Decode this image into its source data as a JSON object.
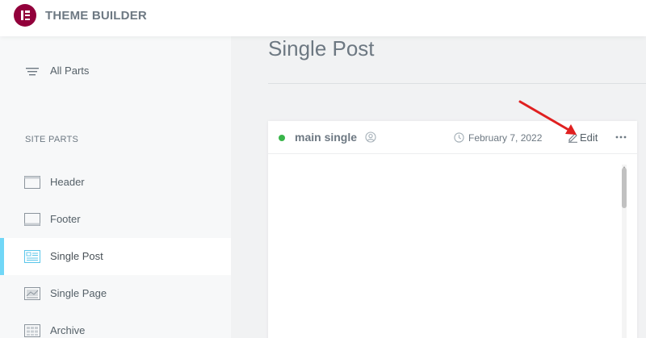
{
  "app": {
    "title": "THEME BUILDER"
  },
  "sidebar": {
    "all_parts_label": "All Parts",
    "section_label": "SITE PARTS",
    "items": [
      {
        "label": "Header",
        "icon": "header-template-icon"
      },
      {
        "label": "Footer",
        "icon": "footer-template-icon"
      },
      {
        "label": "Single Post",
        "icon": "single-post-template-icon",
        "active": true
      },
      {
        "label": "Single Page",
        "icon": "single-page-template-icon"
      },
      {
        "label": "Archive",
        "icon": "archive-template-icon"
      }
    ]
  },
  "main": {
    "page_title": "Single Post",
    "card": {
      "title": "main single",
      "status": "active",
      "date": "February 7, 2022",
      "edit_label": "Edit"
    }
  },
  "colors": {
    "brand": "#92003b",
    "active_accent": "#71d7f7",
    "status_dot": "#39b54a",
    "annotation_arrow": "#e02020"
  }
}
